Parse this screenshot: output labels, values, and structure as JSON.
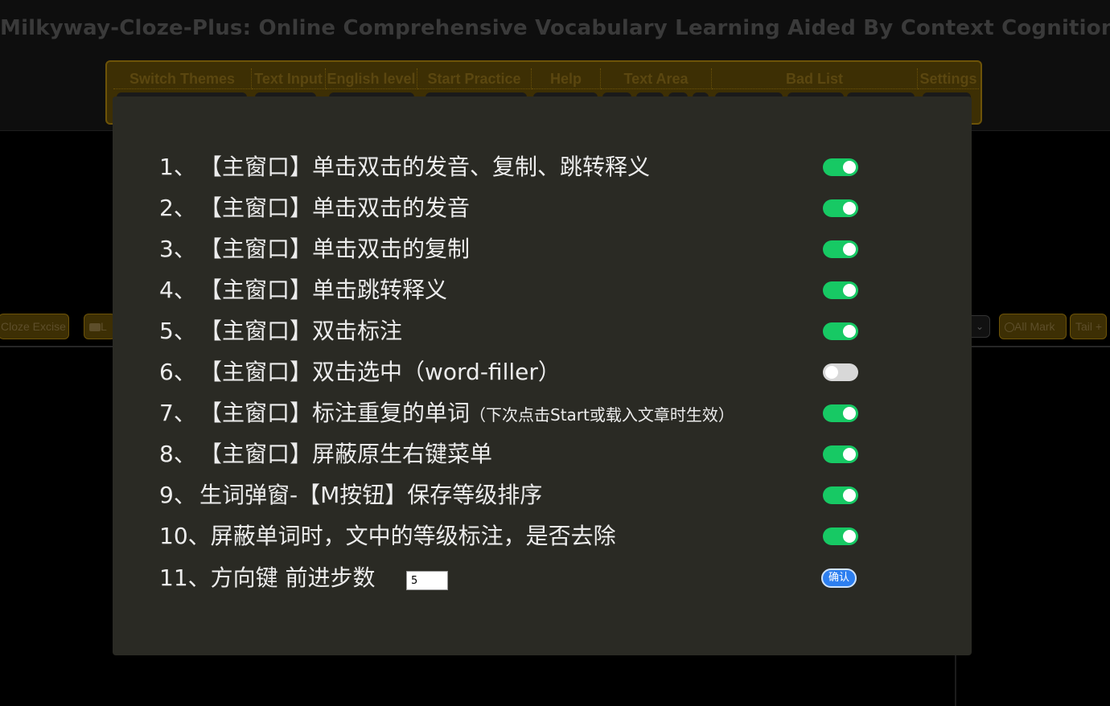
{
  "app": {
    "title": "Milkyway-Cloze-Plus: Online Comprehensive Vocabulary Learning Aided By Context Cognition"
  },
  "menu": {
    "tabs": [
      {
        "label": "Switch Themes"
      },
      {
        "label": "Text Input"
      },
      {
        "label": "English level"
      },
      {
        "label": "Start Practice"
      },
      {
        "label": "Help"
      },
      {
        "label": "Text Area"
      },
      {
        "label": "Bad List"
      },
      {
        "label": "Settings"
      }
    ]
  },
  "toolbar": {
    "cloze_label": "Cloze Excise",
    "folder_label": "L",
    "all_mark_label": "All Mark",
    "tail_label": "Tail +"
  },
  "colors": {
    "toggle_on": "#17c964",
    "toggle_off": "#d8d8d8",
    "accent_blue": "#2d7ff0",
    "dialog_bg": "#2a2a24"
  },
  "settings": {
    "rows": [
      {
        "num": "1、",
        "label": "【主窗口】单击双击的发音、复制、跳转释义",
        "enabled": true
      },
      {
        "num": "2、",
        "label": "【主窗口】单击双击的发音",
        "enabled": true
      },
      {
        "num": "3、",
        "label": "【主窗口】单击双击的复制",
        "enabled": true
      },
      {
        "num": "4、",
        "label": "【主窗口】单击跳转释义",
        "enabled": true
      },
      {
        "num": "5、",
        "label": "【主窗口】双击标注",
        "enabled": true
      },
      {
        "num": "6、",
        "label": "【主窗口】双击选中（word-filler）",
        "enabled": false
      },
      {
        "num": "7、",
        "label": "【主窗口】标注重复的单词",
        "note": "（下次点击Start或载入文章时生效）",
        "enabled": true
      },
      {
        "num": "8、",
        "label": "【主窗口】屏蔽原生右键菜单",
        "enabled": true
      },
      {
        "num": "9、",
        "label": "生词弹窗-【M按钮】保存等级排序",
        "enabled": true
      },
      {
        "num": "",
        "label": "10、屏蔽单词时，文中的等级标注，是否去除",
        "enabled": true
      }
    ],
    "step": {
      "label": "11、方向键 前进步数",
      "value": "5",
      "confirm_label": "确认"
    }
  }
}
